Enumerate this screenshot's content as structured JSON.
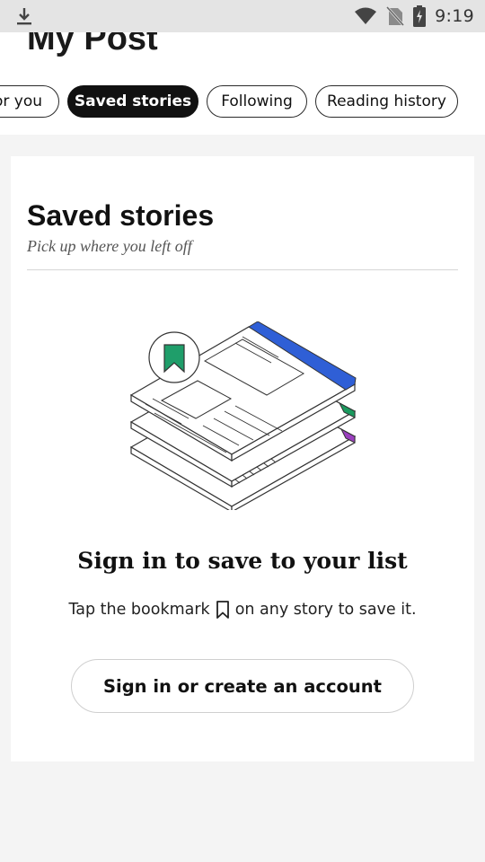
{
  "status_bar": {
    "time": "9:19",
    "icons": [
      "download-icon",
      "wifi-icon",
      "no-sim-icon",
      "battery-charging-icon"
    ]
  },
  "header": {
    "title": "My Post",
    "tabs": [
      {
        "label": "For you",
        "visible_label": "or you",
        "active": false
      },
      {
        "label": "Saved stories",
        "active": true
      },
      {
        "label": "Following",
        "active": false
      },
      {
        "label": "Reading history",
        "active": false
      }
    ]
  },
  "card": {
    "title": "Saved stories",
    "subtitle": "Pick up where you left off",
    "illustration": "stacked-articles-with-bookmark",
    "signin_heading": "Sign in to save to your list",
    "tap_text_before": "Tap the bookmark",
    "tap_text_after": "on any story to save it.",
    "signin_button": "Sign in or create an account"
  },
  "colors": {
    "accent_blue": "#2f5fd6",
    "accent_green": "#1a9a5e",
    "accent_purple": "#9b3fbf",
    "bookmark_green": "#1f9e6a",
    "active_tab": "#111111"
  }
}
